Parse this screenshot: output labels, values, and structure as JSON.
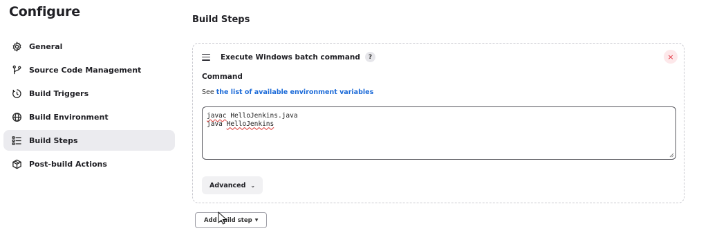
{
  "page": {
    "title": "Configure"
  },
  "sidebar": {
    "items": [
      {
        "label": "General",
        "icon": "gear-icon"
      },
      {
        "label": "Source Code Management",
        "icon": "branch-icon"
      },
      {
        "label": "Build Triggers",
        "icon": "clock-icon"
      },
      {
        "label": "Build Environment",
        "icon": "globe-icon"
      },
      {
        "label": "Build Steps",
        "icon": "list-icon",
        "active": true
      },
      {
        "label": "Post-build Actions",
        "icon": "package-icon"
      }
    ]
  },
  "main": {
    "section_title": "Build Steps",
    "step": {
      "title": "Execute Windows batch command",
      "help_badge": "?",
      "delete_label": "×",
      "field_label": "Command",
      "help_prefix": "See ",
      "help_link": "the list of available environment variables",
      "command_lines": [
        {
          "misspelled": "javac",
          "rest": " HelloJenkins.java"
        },
        {
          "prefix": "java ",
          "misspelled": "HelloJenkins"
        }
      ],
      "advanced_label": "Advanced",
      "advanced_chevron": "⌄"
    },
    "add_step_label": "Add build step",
    "add_step_caret": "▼"
  },
  "colors": {
    "link": "#1b6ad8",
    "active_bg": "#ebebef",
    "delete": "#e0303c"
  }
}
